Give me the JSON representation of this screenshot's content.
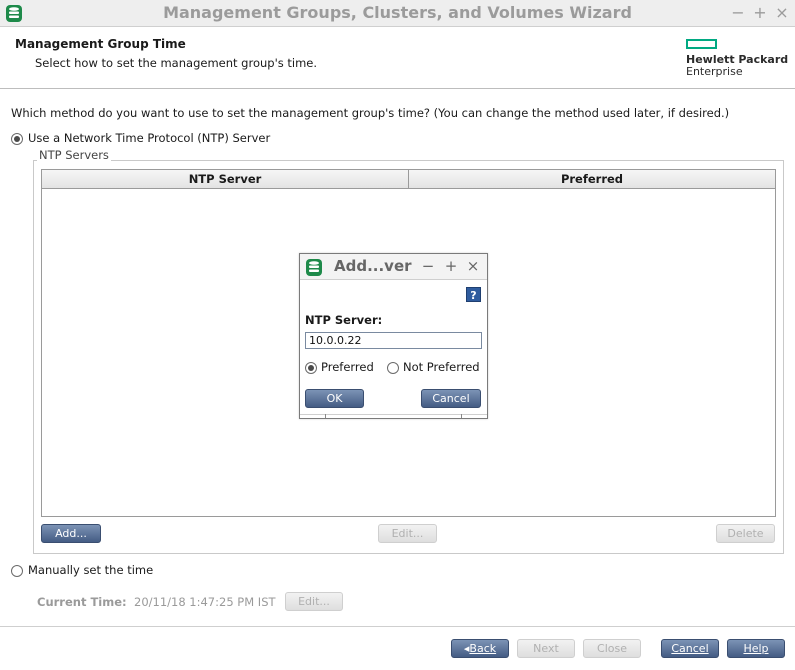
{
  "window": {
    "title": "Management Groups, Clusters, and Volumes Wizard",
    "controls": [
      "−",
      "+",
      "×"
    ]
  },
  "header": {
    "title": "Management Group Time",
    "subtitle": "Select how to set the management group's time.",
    "logo_line1": "Hewlett Packard",
    "logo_line2": "Enterprise",
    "brand_color": "#01a982"
  },
  "question": "Which method do you want to use to set the management group's time? (You can change the method used later, if desired.)",
  "ntp_option": {
    "label": "Use a Network Time Protocol (NTP) Server",
    "selected": true,
    "group_legend": "NTP Servers",
    "columns": [
      "NTP Server",
      "Preferred"
    ],
    "rows": [],
    "add_label": "Add...",
    "edit_label": "Edit...",
    "delete_label": "Delete"
  },
  "manual_option": {
    "label": "Manually set the time",
    "selected": false,
    "current_time_label": "Current Time:",
    "current_time_value": "20/11/18 1:47:25 PM IST",
    "edit_label": "Edit..."
  },
  "footer": {
    "back_label": "Back",
    "next_label": "Next",
    "close_label": "Close",
    "cancel_label": "Cancel",
    "help_label": "Help"
  },
  "dialog": {
    "title": "Add...ver",
    "controls": [
      "−",
      "+",
      "×"
    ],
    "help_icon": "?",
    "ntp_label": "NTP Server:",
    "ntp_value": "10.0.0.22",
    "preferred_label": "Preferred",
    "not_preferred_label": "Not Preferred",
    "preferred_selected": true,
    "ok_label": "OK",
    "cancel_label": "Cancel"
  },
  "icons": {
    "app": "database-icon",
    "help": "help-icon"
  }
}
